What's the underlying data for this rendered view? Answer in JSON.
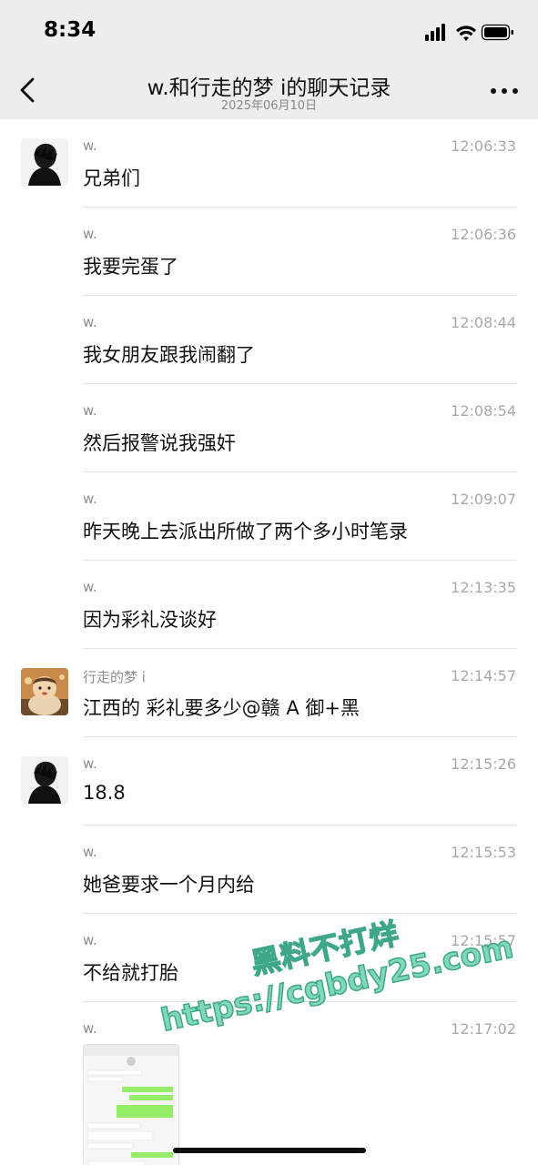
{
  "status_bar": {
    "time": "8:34"
  },
  "header": {
    "title": "w.和行走的梦 i的聊天记录",
    "date": "2025年06月10日"
  },
  "messages": [
    {
      "sender": "w.",
      "time": "12:06:33",
      "text": "兄弟们",
      "avatar": "dark-figure-avatar"
    },
    {
      "sender": "w.",
      "time": "12:06:36",
      "text": "我要完蛋了"
    },
    {
      "sender": "w.",
      "time": "12:08:44",
      "text": "我女朋友跟我闹翻了"
    },
    {
      "sender": "w.",
      "time": "12:08:54",
      "text": "然后报警说我强奸"
    },
    {
      "sender": "w.",
      "time": "12:09:07",
      "text": "昨天晚上去派出所做了两个多小时笔录"
    },
    {
      "sender": "w.",
      "time": "12:13:35",
      "text": "因为彩礼没谈好"
    },
    {
      "sender": "行走的梦 i",
      "time": "12:14:57",
      "text": "江西的 彩礼要多少@赣 A 御+黑",
      "avatar": "cartoon-character-avatar"
    },
    {
      "sender": "w.",
      "time": "12:15:26",
      "text": "18.8",
      "avatar": "dark-figure-avatar"
    },
    {
      "sender": "w.",
      "time": "12:15:53",
      "text": "她爸要求一个月内给"
    },
    {
      "sender": "w.",
      "time": "12:15:57",
      "text": "不给就打胎"
    },
    {
      "sender": "w.",
      "time": "12:17:02",
      "image": "chat-screenshot-thumbnail"
    }
  ],
  "watermark": {
    "line1": "黑料不打烊",
    "line2": "https://cgbdy25.com",
    "color": "#7fd9b6"
  }
}
